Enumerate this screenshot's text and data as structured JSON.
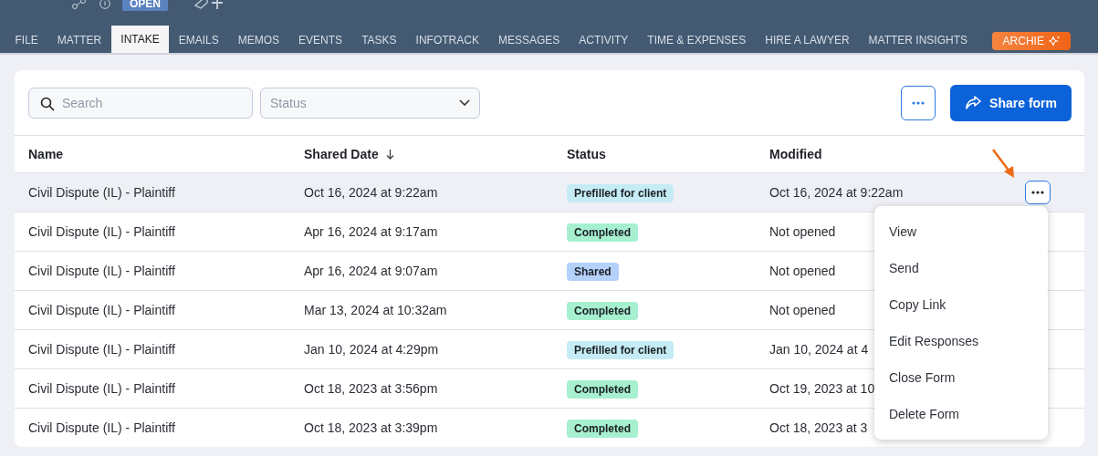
{
  "header": {
    "status_badge": "OPEN"
  },
  "tabs": [
    {
      "label": "FILE",
      "selected": false
    },
    {
      "label": "MATTER",
      "selected": false
    },
    {
      "label": "INTAKE",
      "selected": true
    },
    {
      "label": "EMAILS",
      "selected": false
    },
    {
      "label": "MEMOS",
      "selected": false
    },
    {
      "label": "EVENTS",
      "selected": false
    },
    {
      "label": "TASKS",
      "selected": false
    },
    {
      "label": "INFOTRACK",
      "selected": false
    },
    {
      "label": "MESSAGES",
      "selected": false
    },
    {
      "label": "ACTIVITY",
      "selected": false
    },
    {
      "label": "TIME & EXPENSES",
      "selected": false
    },
    {
      "label": "HIRE A LAWYER",
      "selected": false
    },
    {
      "label": "MATTER INSIGHTS",
      "selected": false
    }
  ],
  "assistant_button": "ARCHIE",
  "toolbar": {
    "search": {
      "placeholder": "Search"
    },
    "status_filter": {
      "placeholder": "Status"
    },
    "share_button": "Share form"
  },
  "table": {
    "columns": [
      "Name",
      "Shared Date",
      "Status",
      "Modified"
    ],
    "rows": [
      {
        "name": "Civil Dispute (IL) - Plaintiff",
        "shared": "Oct 16, 2024 at 9:22am",
        "status": {
          "text": "Prefilled for client",
          "kind": "prefilled"
        },
        "modified": "Oct 16, 2024 at 9:22am",
        "selected": true
      },
      {
        "name": "Civil Dispute (IL) - Plaintiff",
        "shared": "Apr 16, 2024 at 9:17am",
        "status": {
          "text": "Completed",
          "kind": "completed"
        },
        "modified": "Not opened",
        "selected": false
      },
      {
        "name": "Civil Dispute (IL) - Plaintiff",
        "shared": "Apr 16, 2024 at 9:07am",
        "status": {
          "text": "Shared",
          "kind": "shared"
        },
        "modified": "Not opened",
        "selected": false
      },
      {
        "name": "Civil Dispute (IL) - Plaintiff",
        "shared": "Mar 13, 2024 at 10:32am",
        "status": {
          "text": "Completed",
          "kind": "completed"
        },
        "modified": "Not opened",
        "selected": false
      },
      {
        "name": "Civil Dispute (IL) - Plaintiff",
        "shared": "Jan 10, 2024 at 4:29pm",
        "status": {
          "text": "Prefilled for client",
          "kind": "prefilled"
        },
        "modified": "Jan 10, 2024 at 4",
        "selected": false
      },
      {
        "name": "Civil Dispute (IL) - Plaintiff",
        "shared": "Oct 18, 2023 at 3:56pm",
        "status": {
          "text": "Completed",
          "kind": "completed"
        },
        "modified": "Oct 19, 2023 at 10",
        "selected": false
      },
      {
        "name": "Civil Dispute (IL) - Plaintiff",
        "shared": "Oct 18, 2023 at 3:39pm",
        "status": {
          "text": "Completed",
          "kind": "completed"
        },
        "modified": "Oct 18, 2023 at 3",
        "selected": false
      }
    ]
  },
  "row_menu": [
    "View",
    "Send",
    "Copy Link",
    "Edit Responses",
    "Close Form",
    "Delete Form"
  ]
}
